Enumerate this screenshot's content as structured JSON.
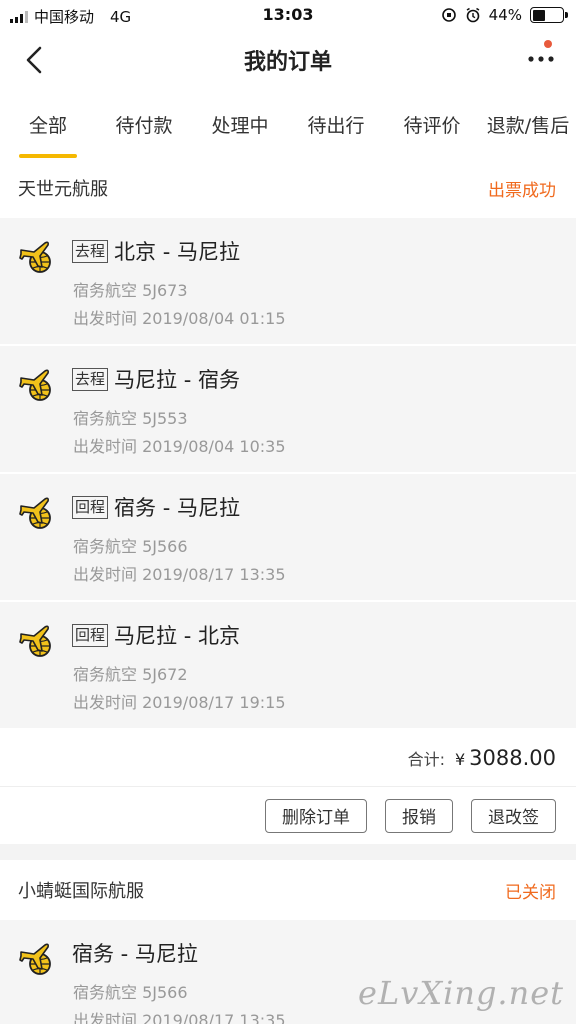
{
  "status_bar": {
    "carrier": "中国移动",
    "network": "4G",
    "time": "13:03",
    "battery": "44%",
    "battery_level": 0.44
  },
  "nav": {
    "title": "我的订单",
    "back_icon": "chevron-left-icon",
    "more_icon": "more-dots-icon",
    "accent": "#f5b800",
    "notify_color": "#e85a3c"
  },
  "tabs": [
    {
      "label": "全部",
      "active": true
    },
    {
      "label": "待付款",
      "active": false
    },
    {
      "label": "处理中",
      "active": false
    },
    {
      "label": "待出行",
      "active": false
    },
    {
      "label": "待评价",
      "active": false
    },
    {
      "label": "退款/售后",
      "active": false
    }
  ],
  "orders": [
    {
      "merchant": "天世元航服",
      "status": "出票成功",
      "status_color": "#f06a1e",
      "flights": [
        {
          "badge": "去程",
          "route": "北京 - 马尼拉",
          "airline_flight": "宿务航空 5J673",
          "departure": "出发时间 2019/08/04 01:15"
        },
        {
          "badge": "去程",
          "route": "马尼拉 - 宿务",
          "airline_flight": "宿务航空 5J553",
          "departure": "出发时间 2019/08/04 10:35"
        },
        {
          "badge": "回程",
          "route": "宿务 - 马尼拉",
          "airline_flight": "宿务航空 5J566",
          "departure": "出发时间 2019/08/17 13:35"
        },
        {
          "badge": "回程",
          "route": "马尼拉 - 北京",
          "airline_flight": "宿务航空 5J672",
          "departure": "出发时间 2019/08/17 19:15"
        }
      ],
      "total_label": "合计:",
      "total_currency": "¥",
      "total_amount": "3088.00",
      "actions": [
        "删除订单",
        "报销",
        "退改签"
      ]
    },
    {
      "merchant": "小蜻蜓国际航服",
      "status": "已关闭",
      "status_color": "#f06a1e",
      "flights": [
        {
          "badge": "",
          "route": "宿务 - 马尼拉",
          "airline_flight": "宿务航空 5J566",
          "departure": "出发时间 2019/08/17 13:35"
        }
      ]
    }
  ],
  "watermark": "eLvXing.net"
}
